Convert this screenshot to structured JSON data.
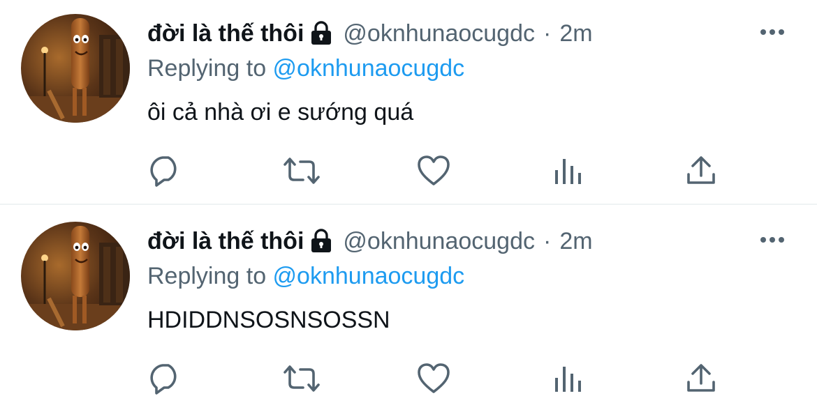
{
  "tweets": [
    {
      "display_name": "đời là thế thôi",
      "handle": "@oknhunaocugdc",
      "separator": "·",
      "time": "2m",
      "replying_prefix": "Replying to",
      "replying_to": "@oknhunaocugdc",
      "text": "ôi cả nhà ơi e sướng quá",
      "icons": [
        "lock-icon",
        "more-icon",
        "reply-icon",
        "retweet-icon",
        "like-icon",
        "analytics-icon",
        "share-icon"
      ]
    },
    {
      "display_name": "đời là thế thôi",
      "handle": "@oknhunaocugdc",
      "separator": "·",
      "time": "2m",
      "replying_prefix": "Replying to",
      "replying_to": "@oknhunaocugdc",
      "text": "HDIDDNSOSNSOSSN",
      "icons": [
        "lock-icon",
        "more-icon",
        "reply-icon",
        "retweet-icon",
        "like-icon",
        "analytics-icon",
        "share-icon"
      ]
    }
  ],
  "colors": {
    "text": "#0f1419",
    "secondary": "#536471",
    "link": "#1d9bf0",
    "divider": "#eff3f4"
  }
}
